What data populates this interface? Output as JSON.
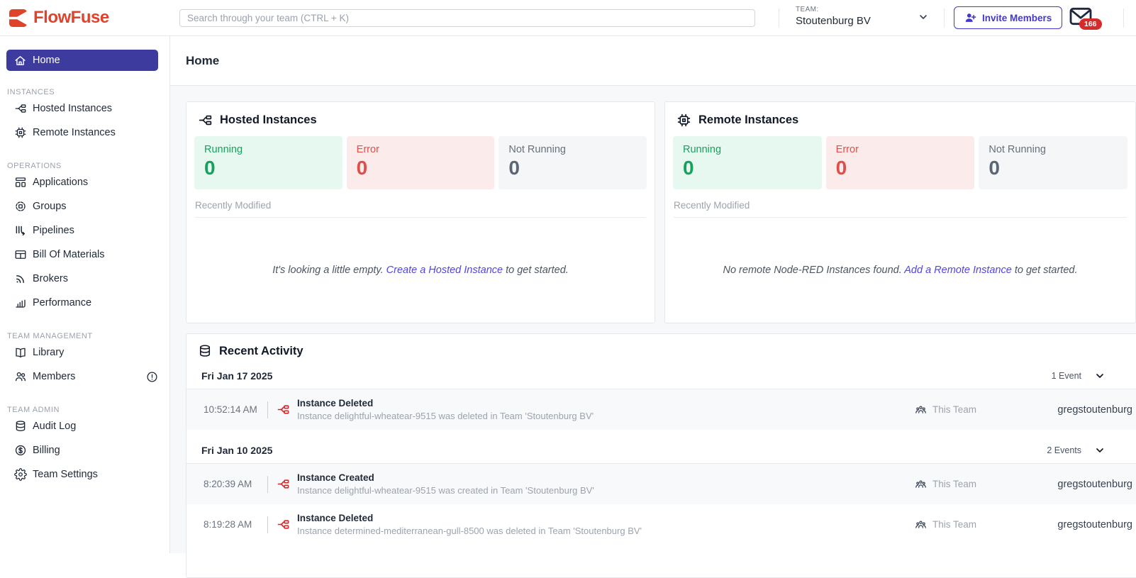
{
  "topbar": {
    "brand": "FlowFuse",
    "search_placeholder": "Search through your team (CTRL + K)",
    "team_label": "TEAM:",
    "team_name": "Stoutenburg BV",
    "invite_label": "Invite Members",
    "mail_badge": "166"
  },
  "sidebar": {
    "home_label": "Home",
    "sections": [
      {
        "label": "INSTANCES",
        "items": [
          {
            "label": "Hosted Instances",
            "icon": "hosted-instances-icon"
          },
          {
            "label": "Remote Instances",
            "icon": "remote-instances-icon"
          }
        ]
      },
      {
        "label": "OPERATIONS",
        "items": [
          {
            "label": "Applications",
            "icon": "applications-icon"
          },
          {
            "label": "Groups",
            "icon": "groups-icon"
          },
          {
            "label": "Pipelines",
            "icon": "pipelines-icon"
          },
          {
            "label": "Bill Of Materials",
            "icon": "bill-of-materials-icon"
          },
          {
            "label": "Brokers",
            "icon": "brokers-icon"
          },
          {
            "label": "Performance",
            "icon": "performance-icon"
          }
        ]
      },
      {
        "label": "TEAM MANAGEMENT",
        "items": [
          {
            "label": "Library",
            "icon": "library-icon"
          },
          {
            "label": "Members",
            "icon": "members-icon",
            "alert": true
          }
        ]
      },
      {
        "label": "TEAM ADMIN",
        "items": [
          {
            "label": "Audit Log",
            "icon": "audit-log-icon"
          },
          {
            "label": "Billing",
            "icon": "billing-icon"
          },
          {
            "label": "Team Settings",
            "icon": "team-settings-icon"
          }
        ]
      }
    ]
  },
  "main": {
    "title": "Home",
    "hosted_card": {
      "title": "Hosted Instances",
      "icon": "hosted-instances-icon",
      "stats": [
        {
          "label": "Running",
          "value": "0",
          "color": "#18a15d"
        },
        {
          "label": "Error",
          "value": "0",
          "color": "#e14e49"
        },
        {
          "label": "Not Running",
          "value": "0",
          "color": "#5a6575"
        }
      ],
      "recently_modified_label": "Recently Modified",
      "empty_prefix": "It's looking a little empty. ",
      "empty_link": "Create a Hosted Instance",
      "empty_suffix": " to get started."
    },
    "remote_card": {
      "title": "Remote Instances",
      "icon": "remote-instances-icon",
      "stats": [
        {
          "label": "Running",
          "value": "0",
          "color": "#18a15d"
        },
        {
          "label": "Error",
          "value": "0",
          "color": "#e14e49"
        },
        {
          "label": "Not Running",
          "value": "0",
          "color": "#5a6575"
        }
      ],
      "recently_modified_label": "Recently Modified",
      "empty_prefix": "No remote Node-RED Instances found. ",
      "empty_link": "Add a Remote Instance",
      "empty_suffix": " to get started."
    },
    "activity": {
      "title": "Recent Activity",
      "icon": "database-icon",
      "groups": [
        {
          "date": "Fri Jan 17 2025",
          "count_label": "1 Event",
          "events": [
            {
              "time": "10:52:14 AM",
              "title": "Instance Deleted",
              "description": "Instance delightful-wheatear-9515 was deleted in Team 'Stoutenburg BV'",
              "scope": "This Team",
              "user": "gregstoutenburg"
            }
          ]
        },
        {
          "date": "Fri Jan 10 2025",
          "count_label": "2 Events",
          "events": [
            {
              "time": "8:20:39 AM",
              "title": "Instance Created",
              "description": "Instance delightful-wheatear-9515 was created in Team 'Stoutenburg BV'",
              "scope": "This Team",
              "user": "gregstoutenburg"
            },
            {
              "time": "8:19:28 AM",
              "title": "Instance Deleted",
              "description": "Instance determined-mediterranean-gull-8500 was deleted in Team 'Stoutenburg BV'",
              "scope": "This Team",
              "user": "gregstoutenburg"
            }
          ]
        }
      ]
    }
  },
  "colors": {
    "brand_red": "#e0432c",
    "accent_indigo": "#3d3b9e",
    "invite_indigo": "#4338ca",
    "link": "#4f46e5",
    "success": "#18a15d",
    "success_bg": "#e6f8ef",
    "error": "#e14e49",
    "error_bg": "#fcebeb",
    "neutral_bg": "#f4f6f8",
    "badge_red": "#d52b2b",
    "activity_icon_red": "#d42a2a",
    "page_bg": "#f7f8fa"
  }
}
